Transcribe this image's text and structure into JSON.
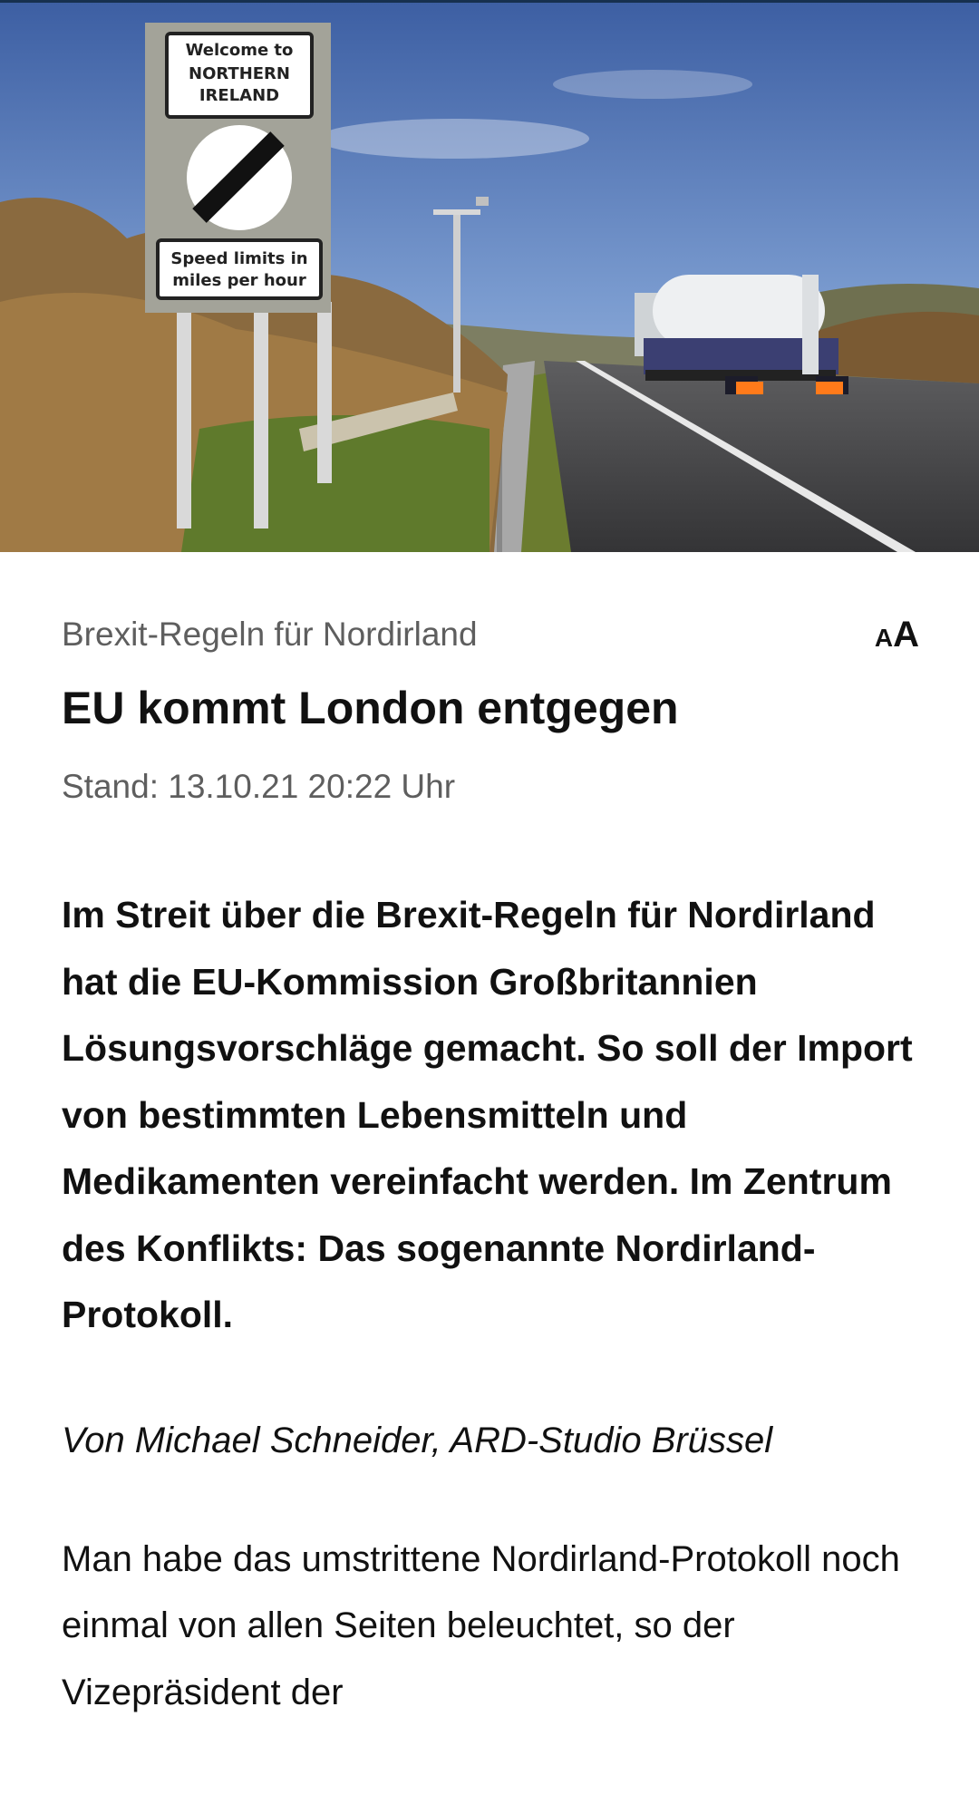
{
  "hero": {
    "sign_text": [
      "Welcome to",
      "NORTHERN",
      "IRELAND"
    ],
    "speed_text": [
      "Speed limits in",
      "miles per hour"
    ]
  },
  "article": {
    "topline": "Brexit-Regeln für Nordirland",
    "font_toggle": {
      "small": "A",
      "big": "A"
    },
    "headline": "EU kommt London entgegen",
    "date": "Stand: 13.10.21 20:22 Uhr",
    "lead": "Im Streit über die Brexit-Regeln für Nordirland hat die EU-Kommission Großbritannien Lösungsvorschläge gemacht. So soll der Import von bestimmten Lebensmitteln und Medikamenten vereinfacht werden. Im Zentrum des Konflikts: Das sogenannte Nordirland-Protokoll.",
    "author": "Von Michael Schneider, ARD-Studio Brüssel",
    "body": "Man habe das umstrittene Nordirland-Protokoll noch einmal von allen Seiten beleuchtet, so der Vizepräsident der"
  },
  "colors": {
    "accent": "#16304f",
    "meta_text": "#5e5e5e"
  }
}
